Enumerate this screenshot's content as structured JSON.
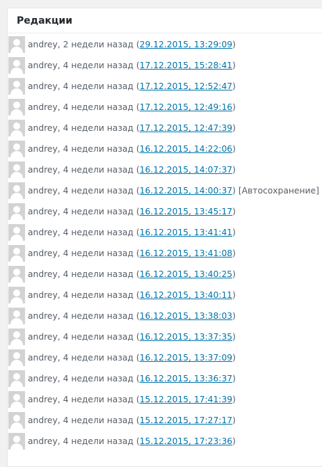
{
  "panel": {
    "title": "Редакции"
  },
  "revisions": [
    {
      "author": "andrey",
      "ago": "2 недели назад",
      "date": "29.12.2015, 13:29:09",
      "note": ""
    },
    {
      "author": "andrey",
      "ago": "4 недели назад",
      "date": "17.12.2015, 15:28:41",
      "note": ""
    },
    {
      "author": "andrey",
      "ago": "4 недели назад",
      "date": "17.12.2015, 12:52:47",
      "note": ""
    },
    {
      "author": "andrey",
      "ago": "4 недели назад",
      "date": "17.12.2015, 12:49:16",
      "note": ""
    },
    {
      "author": "andrey",
      "ago": "4 недели назад",
      "date": "17.12.2015, 12:47:39",
      "note": ""
    },
    {
      "author": "andrey",
      "ago": "4 недели назад",
      "date": "16.12.2015, 14:22:06",
      "note": ""
    },
    {
      "author": "andrey",
      "ago": "4 недели назад",
      "date": "16.12.2015, 14:07:37",
      "note": ""
    },
    {
      "author": "andrey",
      "ago": "4 недели назад",
      "date": "16.12.2015, 14:00:37",
      "note": "[Автосохранение]"
    },
    {
      "author": "andrey",
      "ago": "4 недели назад",
      "date": "16.12.2015, 13:45:17",
      "note": ""
    },
    {
      "author": "andrey",
      "ago": "4 недели назад",
      "date": "16.12.2015, 13:41:41",
      "note": ""
    },
    {
      "author": "andrey",
      "ago": "4 недели назад",
      "date": "16.12.2015, 13:41:08",
      "note": ""
    },
    {
      "author": "andrey",
      "ago": "4 недели назад",
      "date": "16.12.2015, 13:40:25",
      "note": ""
    },
    {
      "author": "andrey",
      "ago": "4 недели назад",
      "date": "16.12.2015, 13:40:11",
      "note": ""
    },
    {
      "author": "andrey",
      "ago": "4 недели назад",
      "date": "16.12.2015, 13:38:03",
      "note": ""
    },
    {
      "author": "andrey",
      "ago": "4 недели назад",
      "date": "16.12.2015, 13:37:35",
      "note": ""
    },
    {
      "author": "andrey",
      "ago": "4 недели назад",
      "date": "16.12.2015, 13:37:09",
      "note": ""
    },
    {
      "author": "andrey",
      "ago": "4 недели назад",
      "date": "16.12.2015, 13:36:37",
      "note": ""
    },
    {
      "author": "andrey",
      "ago": "4 недели назад",
      "date": "15.12.2015, 17:41:39",
      "note": ""
    },
    {
      "author": "andrey",
      "ago": "4 недели назад",
      "date": "15.12.2015, 17:27:17",
      "note": ""
    },
    {
      "author": "andrey",
      "ago": "4 недели назад",
      "date": "15.12.2015, 17:23:36",
      "note": ""
    }
  ],
  "colors": {
    "link": "#0073aa",
    "text": "#555d66",
    "avatar_bg": "#d3d3d3"
  },
  "icons": {
    "avatar": "default-avatar-icon"
  }
}
